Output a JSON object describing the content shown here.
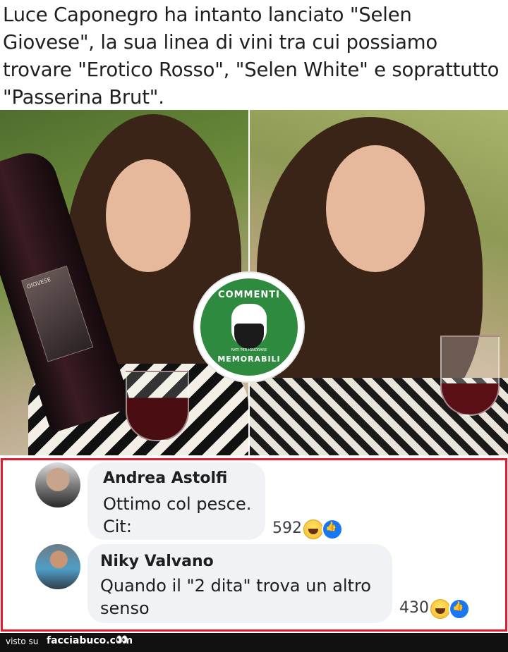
{
  "post": {
    "caption": "Luce Caponegro ha intanto lanciato \"Selen Giovese\", la sua linea di vini tra cui possiamo trovare \"Erotico Rosso\",  \"Selen White\" e soprattutto \"Passerina Brut\"."
  },
  "logo": {
    "top_text": "COMMENTI",
    "small_text": "NATI PER IGNORARE",
    "bottom_text": "MEMORABILI"
  },
  "bottle": {
    "label_text": "GIOVESE"
  },
  "comments": [
    {
      "author": "Andrea Astolfi",
      "lines": [
        "Ottimo col pesce.",
        "Cit:"
      ],
      "reaction_count": "592"
    },
    {
      "author": "Niky Valvano",
      "lines": [
        "Quando il \"2 dita\" trova un altro",
        "senso"
      ],
      "reaction_count": "430"
    }
  ],
  "icons": {
    "haha": "laughing-face-icon",
    "like": "thumbs-up-icon"
  },
  "footer": {
    "prefix": "visto su",
    "site": "facciabuco.com",
    "eyes": "👀"
  },
  "colors": {
    "frame": "#e3192f",
    "bubble": "#f0f2f5",
    "logo_green": "#2d8a3e",
    "like_blue": "#1877f2"
  }
}
